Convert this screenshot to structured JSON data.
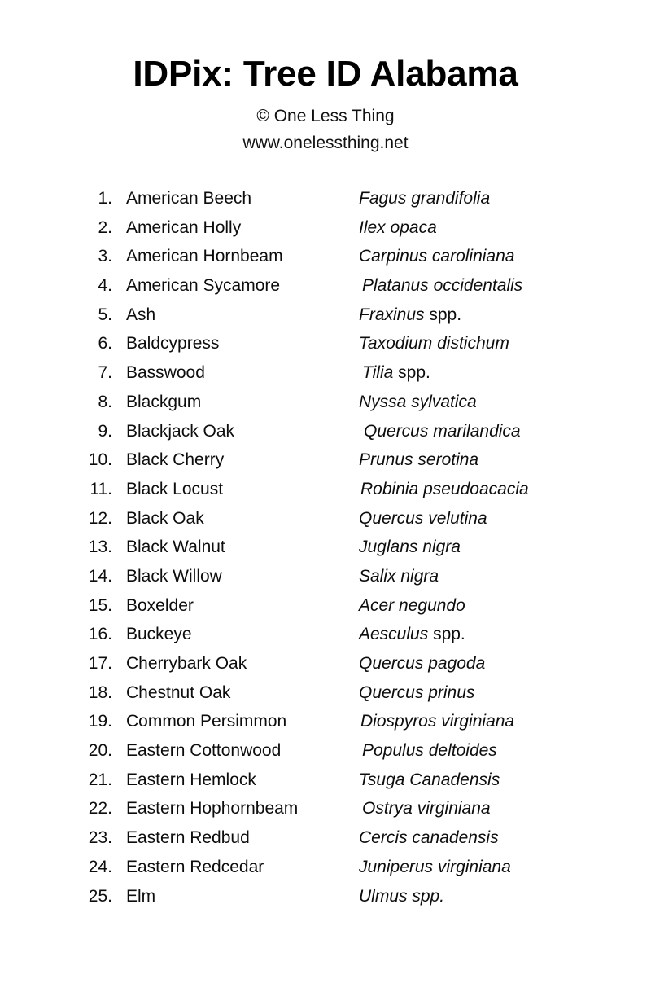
{
  "header": {
    "title": "IDPix: Tree ID Alabama",
    "copyright": "© One Less Thing",
    "website": "www.onelessthing.net"
  },
  "list": {
    "items": [
      {
        "number": "1.",
        "common": "American Beech",
        "genus": "Fagus",
        "species": "grandifolia",
        "species_upright": false,
        "indent": 0
      },
      {
        "number": "2.",
        "common": "American Holly",
        "genus": "Ilex",
        "species": "opaca",
        "species_upright": false,
        "indent": 0
      },
      {
        "number": "3.",
        "common": "American Hornbeam",
        "genus": "Carpinus",
        "species": "caroliniana",
        "species_upright": false,
        "indent": 0
      },
      {
        "number": "4.",
        "common": "American Sycamore",
        "genus": "Platanus",
        "species": "occidentalis",
        "species_upright": false,
        "indent": 4
      },
      {
        "number": "5.",
        "common": "Ash",
        "genus": "Fraxinus",
        "species": "spp.",
        "species_upright": true,
        "indent": 0
      },
      {
        "number": "6.",
        "common": "Baldcypress",
        "genus": "Taxodium",
        "species": "distichum",
        "species_upright": false,
        "indent": 0
      },
      {
        "number": "7.",
        "common": "Basswood",
        "genus": "Tilia",
        "species": "spp.",
        "species_upright": true,
        "indent": 4
      },
      {
        "number": "8.",
        "common": "Blackgum",
        "genus": "Nyssa",
        "species": "sylvatica",
        "species_upright": false,
        "indent": 0
      },
      {
        "number": "9.",
        "common": "Blackjack Oak",
        "genus": "Quercus",
        "species": "marilandica",
        "species_upright": false,
        "indent": 6
      },
      {
        "number": "10.",
        "common": "Black Cherry",
        "genus": "Prunus",
        "species": "serotina",
        "species_upright": false,
        "indent": 0
      },
      {
        "number": "11.",
        "common": "Black Locust",
        "genus": "Robinia",
        "species": "pseudoacacia",
        "species_upright": false,
        "indent": 2
      },
      {
        "number": "12.",
        "common": "Black Oak",
        "genus": "Quercus",
        "species": "velutina",
        "species_upright": false,
        "indent": 0
      },
      {
        "number": "13.",
        "common": "Black Walnut",
        "genus": "Juglans",
        "species": "nigra",
        "species_upright": false,
        "indent": 0
      },
      {
        "number": "14.",
        "common": "Black Willow",
        "genus": "Salix",
        "species": "nigra",
        "species_upright": false,
        "indent": 0
      },
      {
        "number": "15.",
        "common": "Boxelder",
        "genus": "Acer",
        "species": "negundo",
        "species_upright": false,
        "indent": 0
      },
      {
        "number": "16.",
        "common": "Buckeye",
        "genus": "Aesculus",
        "species": "spp.",
        "species_upright": true,
        "indent": 0
      },
      {
        "number": "17.",
        "common": "Cherrybark Oak",
        "genus": "Quercus",
        "species": "pagoda",
        "species_upright": false,
        "indent": 0
      },
      {
        "number": "18.",
        "common": "Chestnut Oak",
        "genus": "Quercus",
        "species": "prinus",
        "species_upright": false,
        "indent": 0
      },
      {
        "number": "19.",
        "common": "Common Persimmon",
        "genus": "Diospyros",
        "species": "virginiana",
        "species_upright": false,
        "indent": 2
      },
      {
        "number": "20.",
        "common": "Eastern Cottonwood",
        "genus": "Populus",
        "species": "deltoides",
        "species_upright": false,
        "indent": 4
      },
      {
        "number": "21.",
        "common": "Eastern Hemlock",
        "genus": "Tsuga",
        "species": "Canadensis",
        "species_upright": false,
        "indent": 0
      },
      {
        "number": "22.",
        "common": "Eastern Hophornbeam",
        "genus": "Ostrya",
        "species": "virginiana",
        "species_upright": false,
        "indent": 4
      },
      {
        "number": "23.",
        "common": "Eastern Redbud",
        "genus": "Cercis",
        "species": "canadensis",
        "species_upright": false,
        "indent": 0
      },
      {
        "number": "24.",
        "common": "Eastern Redcedar",
        "genus": "Juniperus",
        "species": "virginiana",
        "species_upright": false,
        "indent": 0
      },
      {
        "number": "25.",
        "common": "Elm",
        "genus": "Ulmus",
        "species": "spp.",
        "species_upright": false,
        "indent": 0
      }
    ]
  }
}
